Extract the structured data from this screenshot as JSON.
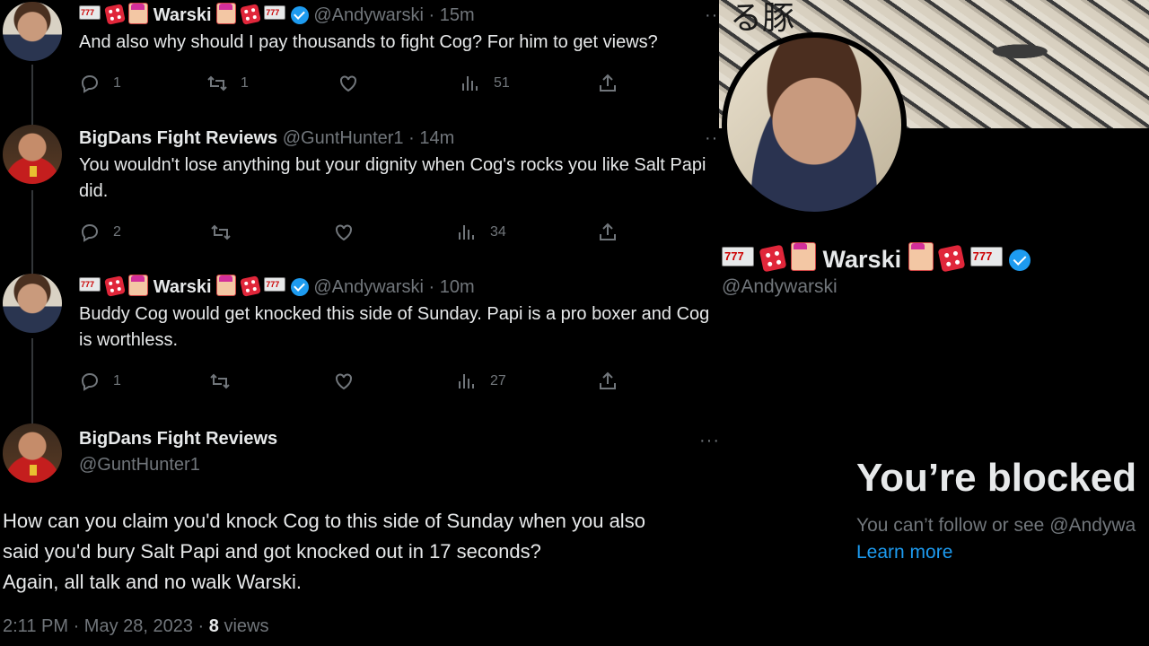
{
  "replies": [
    {
      "author_name": "Warski",
      "handle": "@Andywarski",
      "time": "15m",
      "verified": true,
      "text": "And also why should I pay thousands to fight Cog? For him to get views?",
      "replies": "1",
      "retweets": "1",
      "likes": "",
      "views": "51"
    },
    {
      "author_name": "BigDans Fight Reviews",
      "handle": "@GuntHunter1",
      "time": "14m",
      "verified": false,
      "text": "You wouldn't lose anything but your dignity when Cog's rocks you like Salt Papi did.",
      "replies": "2",
      "retweets": "",
      "likes": "",
      "views": "34"
    },
    {
      "author_name": "Warski",
      "handle": "@Andywarski",
      "time": "10m",
      "verified": true,
      "text": "Buddy Cog would get knocked this side of Sunday. Papi is a pro boxer and Cog is worthless.",
      "replies": "1",
      "retweets": "",
      "likes": "",
      "views": "27"
    }
  ],
  "main_tweet": {
    "author_name": "BigDans Fight Reviews",
    "handle": "@GuntHunter1",
    "text_lines": [
      "How can you claim you'd knock Cog to this side of Sunday when you also",
      "said you'd bury Salt Papi and got knocked out in 17 seconds?",
      "Again, all talk and no walk Warski."
    ],
    "time": "2:11 PM",
    "date": "May 28, 2023",
    "views_count": "8",
    "views_label": "views"
  },
  "profile": {
    "name": "Warski",
    "handle": "@Andywarski",
    "verified": true,
    "banner_glyph": "る豚",
    "blocked_title": "You’re blocked",
    "blocked_sub": "You can’t follow or see @Andywa",
    "learn_more": "Learn more"
  },
  "icons": {
    "reply": "reply-icon",
    "retweet": "retweet-icon",
    "like": "heart-icon",
    "views": "views-icon",
    "share": "share-icon",
    "more": "more-icon",
    "verified": "verified-badge-icon"
  },
  "colors": {
    "background": "#000000",
    "text": "#e7e9ea",
    "muted": "#71767b",
    "accent": "#1d9bf0"
  }
}
